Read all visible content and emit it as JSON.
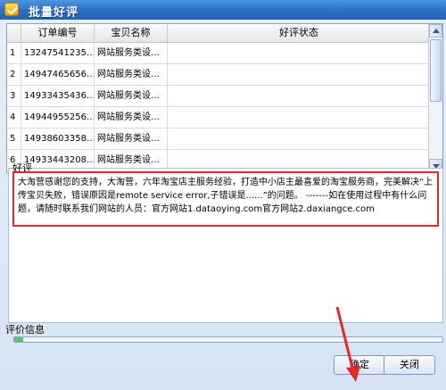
{
  "window": {
    "title": "批量好评"
  },
  "table": {
    "columns": [
      "",
      "订单编号",
      "宝贝名称",
      "好评状态"
    ],
    "rows": [
      {
        "idx": "1",
        "order": "13247541235…",
        "name": "网站服务类设…",
        "status": ""
      },
      {
        "idx": "2",
        "order": "14947465656…",
        "name": "网站服务类设…",
        "status": ""
      },
      {
        "idx": "3",
        "order": "14933435436…",
        "name": "网站服务类设…",
        "status": ""
      },
      {
        "idx": "4",
        "order": "14944955256…",
        "name": "网站服务类设…",
        "status": ""
      },
      {
        "idx": "5",
        "order": "14938603358…",
        "name": "网站服务类设…",
        "status": ""
      },
      {
        "idx": "6",
        "order": "14933443208…",
        "name": "网站服务类设…",
        "status": ""
      }
    ]
  },
  "review": {
    "label": "好评",
    "text": "大淘营感谢您的支持，大淘营，六年淘宝店主服务经验，打造中小店主最喜爱的淘宝服务商，完美解决“上传宝贝失败，错误原因是remote service error,子错误是......”的问题。 -------如在使用过程中有什么问题，请随时联系我们网站的人员：官方网站1.dataoying.com官方网站2.daxiangce.com"
  },
  "evaluation": {
    "label": "评价信息",
    "progress": 0.02
  },
  "buttons": {
    "confirm": "确定",
    "close": "关闭"
  },
  "colors": {
    "highlight": "#e32a2a",
    "titlebar": "#2b6fc4",
    "progress": "#5ac85a"
  }
}
